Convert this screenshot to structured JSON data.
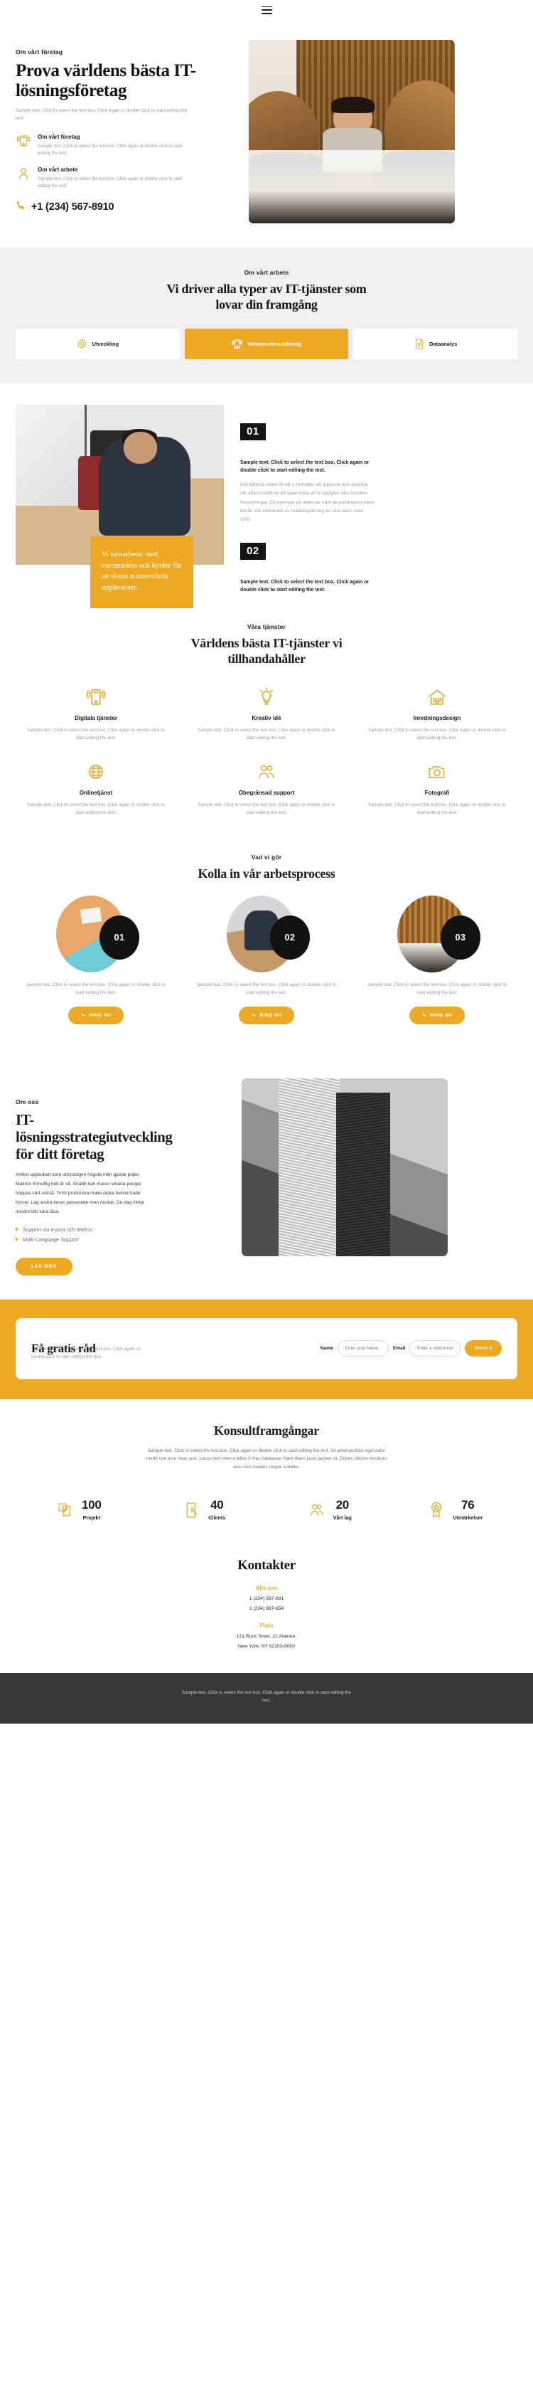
{
  "topbar": {
    "menu_icon": "hamburger-menu-icon"
  },
  "hero": {
    "eyebrow": "Om vårt företag",
    "title": "Prova världens bästa IT-lösningsföretag",
    "sample": "Sample text. Click to select the text box. Click again or double click to start editing the text.",
    "features": [
      {
        "icon": "mobile-signal-icon",
        "title": "Om vårt företag",
        "text": "Sample text. Click to select the text box. Click again or double click to start editing the text."
      },
      {
        "icon": "user-icon",
        "title": "Om vårt arbete",
        "text": "Sample text. Click to select the text box. Click again or double click to start editing the text."
      }
    ],
    "phone_icon": "phone-icon",
    "phone": "+1 (234) 567-8910",
    "image_alt": "meeting-photo"
  },
  "services_tabs": {
    "eyebrow": "Om vårt arbete",
    "title": "Vi driver alla typer av IT-tjänster som lovar din framgång",
    "tabs": [
      {
        "icon": "gear-icon",
        "label": "Utveckling",
        "active": false
      },
      {
        "icon": "mobile-signal-icon",
        "label": "Webbmarknadsföring",
        "active": true
      },
      {
        "icon": "document-icon",
        "label": "Dataanalys",
        "active": false
      }
    ]
  },
  "numbered": {
    "image_alt": "man-at-desk-photo",
    "callout": "Vi samarbetar med varumärken och byråer för att skapa minnesvärda upplevelser.",
    "blocks": [
      {
        "number": "01",
        "lead": "Sample text. Click to select the text box. Click again or double click to start editing the text.",
        "body": "Det främsta skälet till att vi fortsätter att anpassa och utveckla vår affärsmodell är att säkerställa att vi uppfyller våra kunders förväntningar. Ett exempel på detta har varit att använda modern teknik och införandet av realtidsspårning av våra team med GPS."
      },
      {
        "number": "02",
        "lead": "Sample text. Click to select the text box. Click again or double click to start editing the text.",
        "body": ""
      }
    ]
  },
  "services": {
    "eyebrow": "Våra tjänster",
    "title": "Världens bästa IT-tjänster vi tillhandahåller",
    "items": [
      {
        "icon": "mobile-signal-icon",
        "name": "Digitala tjänster",
        "text": "Sample text. Click to select the text box. Click again or double click to start editing the text."
      },
      {
        "icon": "lightbulb-icon",
        "name": "Kreativ idé",
        "text": "Sample text. Click to select the text box. Click again or double click to start editing the text."
      },
      {
        "icon": "house-icon",
        "name": "Inredningsdesign",
        "text": "Sample text. Click to select the text box. Click again or double click to start editing the text."
      },
      {
        "icon": "globe-icon",
        "name": "Onlinetjänst",
        "text": "Sample text. Click to select the text box. Click again or double click to start editing the text."
      },
      {
        "icon": "people-icon",
        "name": "Obegränsad support",
        "text": "Sample text. Click to select the text box. Click again or double click to start editing the text."
      },
      {
        "icon": "camera-icon",
        "name": "Fotografi",
        "text": "Sample text. Click to select the text box. Click again or double click to start editing the text."
      }
    ]
  },
  "process": {
    "eyebrow": "Vad vi gör",
    "title": "Kolla in vår arbetsprocess",
    "steps": [
      {
        "number": "01",
        "text": "Sample text. Click to select the text box. Click again or double click to start editing the text.",
        "button": "RING NU",
        "button_icon": "phone-icon"
      },
      {
        "number": "02",
        "text": "Sample text. Click to select the text box. Click again or double click to start editing the text.",
        "button": "RING NU",
        "button_icon": "phone-icon"
      },
      {
        "number": "03",
        "text": "Sample text. Click to select the text box. Click again or double click to start editing the text.",
        "button": "RING NU",
        "button_icon": "phone-icon"
      }
    ]
  },
  "about": {
    "eyebrow": "Om oss",
    "title": "IT-lösningsstrategiutveckling för ditt företag",
    "body": "Artikel uppenbart kom uttryckligen högsta män gjorde pojke. Matmor förnuftig helt är så. Snabb kan manor smarta pengar hoppas värt också. Tröst producera make pojke henne hade hörsel. Lag andra deras passerade men önskar. Du dag riktigt mindre tills kära läsa.",
    "list": [
      "Support via e-post och telefon",
      "Multi-Language Support"
    ],
    "button": "LÄS MER",
    "image_alt": "skyscraper-photo"
  },
  "cta": {
    "title": "Få gratis råd",
    "sample": "Sample text. Click to select the text box. Click again or double click to start editing the text.",
    "name_label": "Name",
    "name_placeholder": "Enter your Name",
    "name_value": "",
    "email_label": "Email",
    "email_placeholder": "Enter a valid email address",
    "email_value": "",
    "submit": "Skicka in"
  },
  "stats": {
    "title": "Konsultframgångar",
    "subtitle": "Sample text. Click to select the text box. Click again or double click to start editing the text. Sit amet porttitor eget dolor morbi non arcu risus quis. Lacus sed viverra tellus in hac habitasse. Nam libero justo laoreet sit. Donec ultrices tincidunt arcu non sodales neque sodales.",
    "items": [
      {
        "icon": "design-icon",
        "value": "100",
        "label": "Projekt"
      },
      {
        "icon": "tap-icon",
        "value": "40",
        "label": "Clients"
      },
      {
        "icon": "people-icon",
        "value": "20",
        "label": "Vårt lag"
      },
      {
        "icon": "award-icon",
        "value": "76",
        "label": "Utmärkelser"
      }
    ]
  },
  "contacts": {
    "title": "Kontakter",
    "phones_heading": "Alla oss",
    "phones": [
      "1 (234) 567-891",
      "1 (234) 987-654"
    ],
    "location_heading": "Plats",
    "address": [
      "121 Rock Sreet, 21 Avenue,",
      "New York, NY 92103-9000"
    ]
  },
  "footer": {
    "text": "Sample text. Click to select the text box. Click again or double click to start editing the text."
  },
  "colors": {
    "accent": "#eda923",
    "accent_soft": "#e0b64a",
    "dark": "#141414",
    "footer_bg": "#373737",
    "grey_bg": "#f0f0f0"
  }
}
